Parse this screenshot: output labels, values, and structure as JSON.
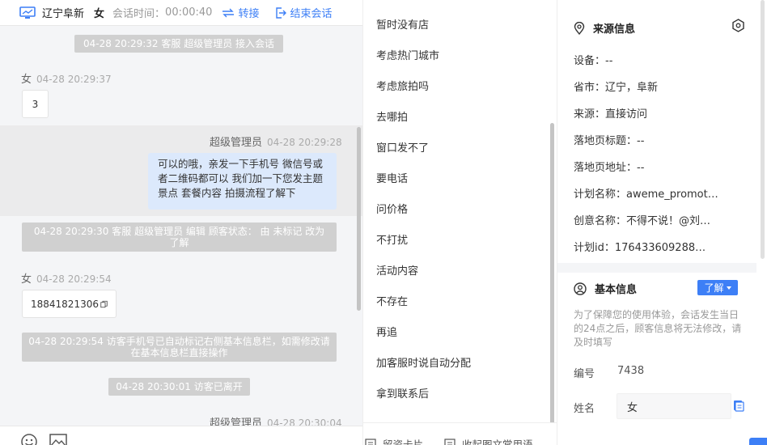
{
  "header": {
    "location": "辽宁阜新",
    "gender": "女",
    "duration_label": "会话时间：",
    "duration": "00:00:40",
    "transfer_label": "转接",
    "end_label": "结束会话"
  },
  "messages": {
    "sys1": "04-28 20:29:32 客服 超级管理员 接入会话",
    "visitor1_name": "女",
    "visitor1_time": "04-28 20:29:37",
    "visitor1_text": "3",
    "agent1_name": "超级管理员",
    "agent1_time": "04-28 20:29:28",
    "agent1_text": "可以的哦，亲发一下手机号 微信号或者二维码都可以 我们加一下您发主题景点 套餐内容 拍摄流程了解下",
    "sys2": "04-28 20:29:30 客服 超级管理员 编辑 顾客状态： 由 未标记 改为 了解",
    "visitor2_name": "女",
    "visitor2_time": "04-28 20:29:54",
    "visitor2_text": "18841821306",
    "sys3": "04-28 20:29:54 访客手机号已自动标记右侧基本信息栏，如需修改请在基本信息栏直接操作",
    "sys4": "04-28 20:30:01 访客已离开",
    "agent2_name": "超级管理员",
    "agent2_time": "04-28 20:30:04"
  },
  "phrases": [
    "暂时没有店",
    "考虑热门城市",
    "考虑旅拍吗",
    "去哪拍",
    "窗口发不了",
    "要电话",
    "问价格",
    "不打扰",
    "活动内容",
    "不存在",
    "再追",
    "加客服时说自动分配",
    "拿到联系后"
  ],
  "phrases_footer": {
    "card_label": "留资卡片",
    "collapse_label": "收起图文常用语"
  },
  "source": {
    "title": "来源信息",
    "device": "设备：--",
    "province": "省市：辽宁，阜新",
    "origin": "来源：直接访问",
    "landing_title": "落地页标题：--",
    "landing_url": "落地页地址：--",
    "plan_name": "计划名称：aweme_promot…",
    "creative_name": "创意名称：不得不说！@刘…",
    "plan_id": "计划id：176433609288…"
  },
  "basic": {
    "title": "基本信息",
    "status_label": "了解",
    "notice": "为了保障您的使用体验，会话发生当日的24点之后，顾客信息将无法修改，请及时填写",
    "id_label": "编号",
    "id_value": "7438",
    "name_label": "姓名",
    "name_value": "女"
  },
  "colors": {
    "accent": "#3d7ff6",
    "agent_bubble": "#dce9fc",
    "system_notice": "#d0d0d0"
  }
}
